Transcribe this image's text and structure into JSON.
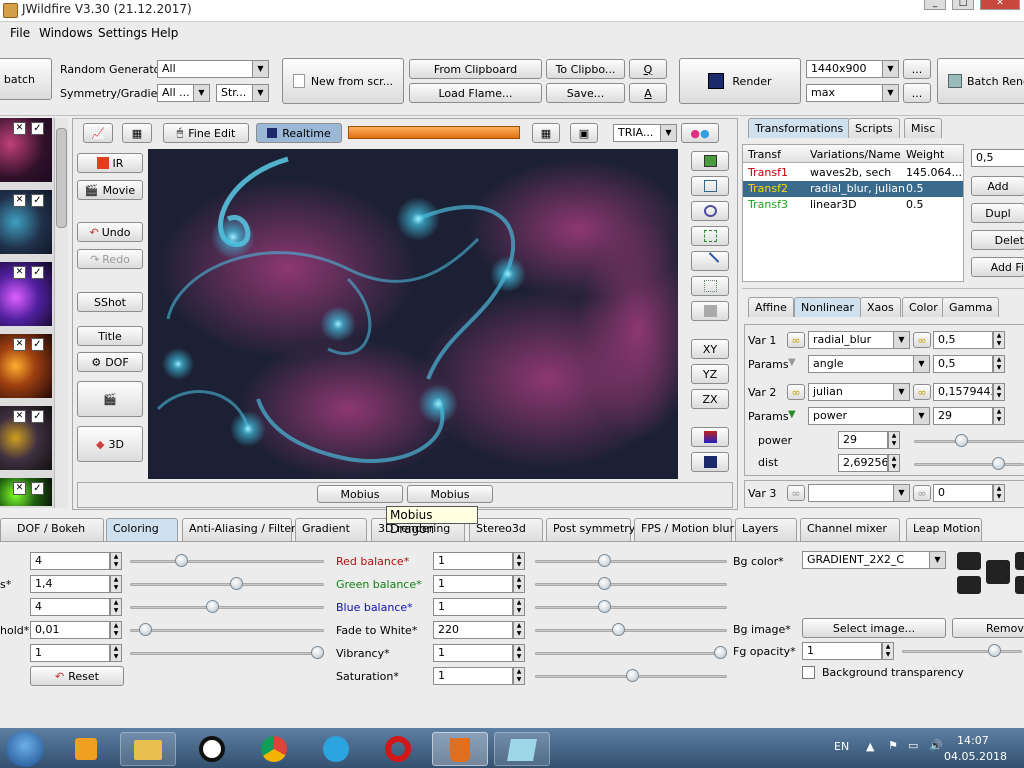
{
  "window": {
    "title": "JWildfire V3.30 (21.12.2017)"
  },
  "menu": [
    "File",
    "Windows",
    "Settings",
    "Help"
  ],
  "toolbar": {
    "batch_label": "n batch",
    "random_generator_label": "Random Generator",
    "random_generator_value": "All",
    "symmetry_label": "Symmetry/Gradient",
    "symmetry_value": "All ...",
    "str_value": "Str...",
    "new_from_script": "New from scr...",
    "from_clipboard": "From Clipboard",
    "load_flame": "Load Flame...",
    "to_clipboard": "To Clipbo...",
    "save": "Save...",
    "q": "Q",
    "a": "A",
    "render": "Render",
    "resolution": "1440x900",
    "quality": "max",
    "ellipsis": "...",
    "batch_render": "Batch Rend"
  },
  "preview_toolbar": {
    "fine_edit": "Fine Edit",
    "realtime": "Realtime",
    "tria": "TRIA..."
  },
  "side_buttons": {
    "ir": "IR",
    "movie": "Movie",
    "undo": "Undo",
    "redo": "Redo",
    "sshot": "SShot",
    "title": "Title",
    "dof": "DOF",
    "3d": "3D"
  },
  "axis_buttons": [
    "XY",
    "YZ",
    "ZX"
  ],
  "bottom_buttons": {
    "mobius1": "Mobius",
    "mobius2": "Mobius",
    "tooltip": "Mobius Dragon"
  },
  "right_tabs": [
    "Transformations",
    "Scripts",
    "Misc"
  ],
  "transforms": {
    "headers": [
      "Transf",
      "Variations/Name",
      "Weight"
    ],
    "rows": [
      {
        "name": "Transf1",
        "var": "waves2b, sech",
        "weight": "145.064...",
        "color": "#c00000"
      },
      {
        "name": "Transf2",
        "var": "radial_blur, julian",
        "weight": "0.5",
        "color": "#ffd800"
      },
      {
        "name": "Transf3",
        "var": "linear3D",
        "weight": "0.5",
        "color": "#18a818"
      }
    ],
    "value_field": "0,5",
    "add": "Add",
    "dupl": "Dupl",
    "delete": "Delet",
    "add_final": "Add Fi"
  },
  "sub_tabs": [
    "Affine",
    "Nonlinear",
    "Xaos",
    "Color",
    "Gamma"
  ],
  "nonlinear": {
    "var1_label": "Var 1",
    "var1_name": "radial_blur",
    "var1_value": "0,5",
    "params1_label": "Params",
    "params1_name": "angle",
    "params1_value": "0,5",
    "var2_label": "Var 2",
    "var2_name": "julian",
    "var2_value": "0,1579443",
    "params2_label": "Params",
    "params2_name": "power",
    "params2_value": "29",
    "power_label": "power",
    "power_value": "29",
    "power_slider": 0.42,
    "dist_label": "dist",
    "dist_value": "2,69256",
    "dist_slider": 0.8,
    "var3_label": "Var 3",
    "var3_name": "",
    "var3_value": "0"
  },
  "bottom_tabs": [
    "DOF / Bokeh",
    "Coloring",
    "Anti-Aliasing / Filter",
    "Gradient",
    "3D rendering",
    "Stereo3d",
    "Post symmetry",
    "FPS / Motion blur",
    "Layers",
    "Channel mixer",
    "Leap Motion"
  ],
  "coloring": {
    "left": [
      {
        "label": "",
        "value": "4",
        "slider": 0.25
      },
      {
        "label": "s*",
        "value": "1,4",
        "slider": 0.55
      },
      {
        "label": "",
        "value": "4",
        "slider": 0.42
      },
      {
        "label": "hold*",
        "value": "0,01",
        "slider": 0.05
      },
      {
        "label": "",
        "value": "1",
        "slider": 1.0
      }
    ],
    "reset": "Reset",
    "middle": [
      {
        "label": "Red balance*",
        "value": "1",
        "slider": 0.35,
        "color": "#b01010"
      },
      {
        "label": "Green balance*",
        "value": "1",
        "slider": 0.35,
        "color": "#108010"
      },
      {
        "label": "Blue balance*",
        "value": "1",
        "slider": 0.35,
        "color": "#1010b0"
      },
      {
        "label": "Fade to White*",
        "value": "220",
        "slider": 0.43,
        "color": "#000000"
      },
      {
        "label": "Vibrancy*",
        "value": "1",
        "slider": 1.0,
        "color": "#000000"
      },
      {
        "label": "Saturation*",
        "value": "1",
        "slider": 0.51,
        "color": "#000000"
      }
    ],
    "bg_color_label": "Bg color*",
    "bg_color_value": "GRADIENT_2X2_C",
    "bg_image_label": "Bg image*",
    "select_image": "Select image...",
    "remove": "Remove",
    "fg_opacity_label": "Fg opacity*",
    "fg_opacity_value": "1",
    "fg_opacity_slider": 0.8,
    "bg_transparency": "Background transparency"
  },
  "taskbar": {
    "lang": "EN",
    "time": "14:07",
    "date": "04.05.2018"
  }
}
